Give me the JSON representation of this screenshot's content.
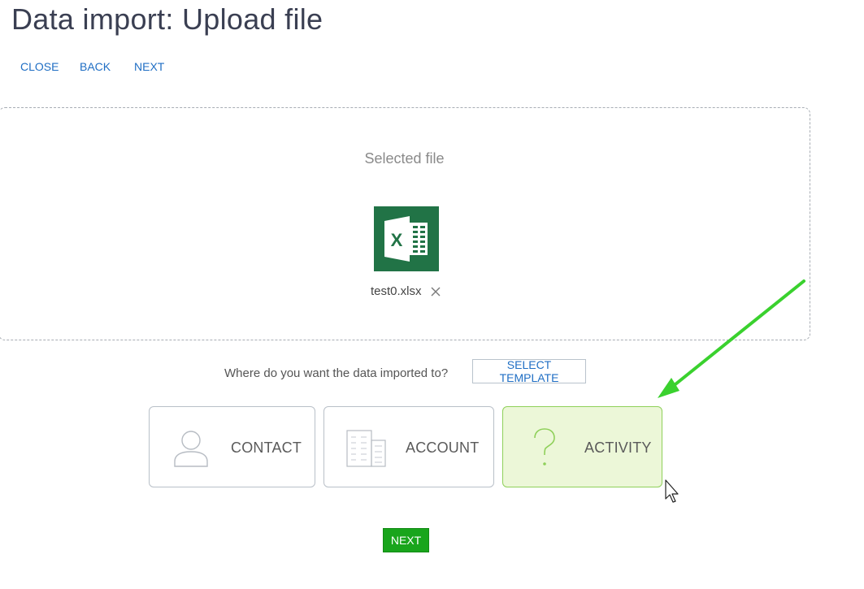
{
  "page": {
    "title": "Data import: Upload file"
  },
  "toolbar": {
    "close_label": "CLOSE",
    "back_label": "BACK",
    "next_label": "NEXT"
  },
  "upload": {
    "selected_file_label": "Selected file",
    "file_name": "test0.xlsx",
    "file_icon": "excel-file-icon",
    "remove_icon": "close-icon"
  },
  "destination": {
    "question": "Where do you want the data imported to?",
    "select_template_label": "SELECT TEMPLATE",
    "options": [
      {
        "label": "CONTACT",
        "icon": "person-icon",
        "selected": false
      },
      {
        "label": "ACCOUNT",
        "icon": "building-icon",
        "selected": false
      },
      {
        "label": "ACTIVITY",
        "icon": "question-icon",
        "selected": true
      }
    ]
  },
  "footer": {
    "next_label": "NEXT"
  },
  "colors": {
    "link": "#1f6ec4",
    "primary_button": "#19a51c",
    "selected_card_bg": "#ecf7d8",
    "selected_card_border": "#8fd05a",
    "excel_green": "#217346",
    "annotation_arrow": "#3ad12e"
  }
}
